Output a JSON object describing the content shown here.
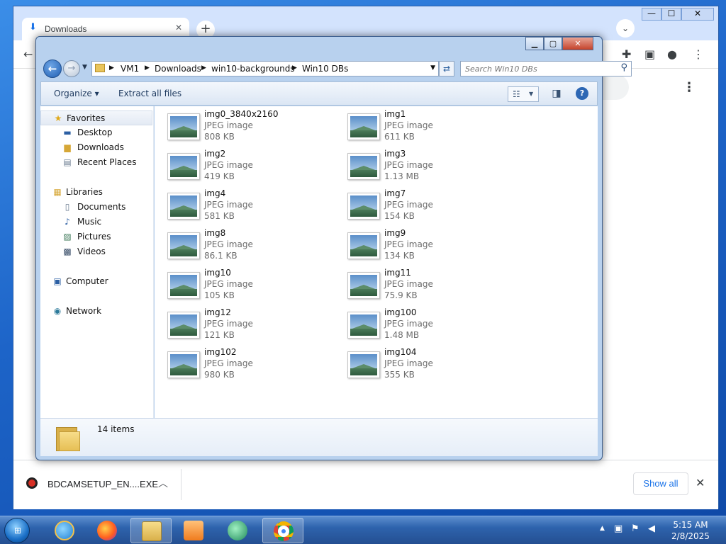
{
  "chrome": {
    "tab_title": "Downloads",
    "tab_icon": "download-icon",
    "new_tab": "+",
    "tab_close": "✕",
    "window_min": "—",
    "window_max": "☐",
    "window_close": "✕",
    "menu_dots": "⋮"
  },
  "shelf": {
    "file_name": "BDCAMSETUP_EN....EXE",
    "show_all": "Show all",
    "close": "✕"
  },
  "explorer": {
    "breadcrumbs": [
      "VM1",
      "Downloads",
      "win10-backgrounds",
      "Win10 DBs"
    ],
    "search_placeholder": "Search Win10 DBs",
    "commands": {
      "organize": "Organize ▾",
      "extract": "Extract all files"
    },
    "nav": {
      "favorites": "Favorites",
      "desktop": "Desktop",
      "downloads": "Downloads",
      "recent": "Recent Places",
      "libraries": "Libraries",
      "documents": "Documents",
      "music": "Music",
      "pictures": "Pictures",
      "videos": "Videos",
      "computer": "Computer",
      "network": "Network"
    },
    "files": [
      {
        "name": "img0_3840x2160",
        "type": "JPEG image",
        "size": "808 KB"
      },
      {
        "name": "img1",
        "type": "JPEG image",
        "size": "611 KB"
      },
      {
        "name": "img2",
        "type": "JPEG image",
        "size": "419 KB"
      },
      {
        "name": "img3",
        "type": "JPEG image",
        "size": "1.13 MB"
      },
      {
        "name": "img4",
        "type": "JPEG image",
        "size": "581 KB"
      },
      {
        "name": "img7",
        "type": "JPEG image",
        "size": "154 KB"
      },
      {
        "name": "img8",
        "type": "JPEG image",
        "size": "86.1 KB"
      },
      {
        "name": "img9",
        "type": "JPEG image",
        "size": "134 KB"
      },
      {
        "name": "img10",
        "type": "JPEG image",
        "size": "105 KB"
      },
      {
        "name": "img11",
        "type": "JPEG image",
        "size": "75.9 KB"
      },
      {
        "name": "img12",
        "type": "JPEG image",
        "size": "121 KB"
      },
      {
        "name": "img100",
        "type": "JPEG image",
        "size": "1.48 MB"
      },
      {
        "name": "img102",
        "type": "JPEG image",
        "size": "980 KB"
      },
      {
        "name": "img104",
        "type": "JPEG image",
        "size": "355 KB"
      }
    ],
    "item_count": "14 items"
  },
  "taskbar": {
    "time": "5:15 AM",
    "date": "2/8/2025",
    "apps": [
      "internet-explorer",
      "firefox",
      "windows-explorer",
      "media-player",
      "bdcam",
      "chrome"
    ]
  },
  "colors": {
    "taskbar": "#2e63ad",
    "explorer_frame": "#b8d1ee",
    "link_blue": "#1a73e8"
  }
}
